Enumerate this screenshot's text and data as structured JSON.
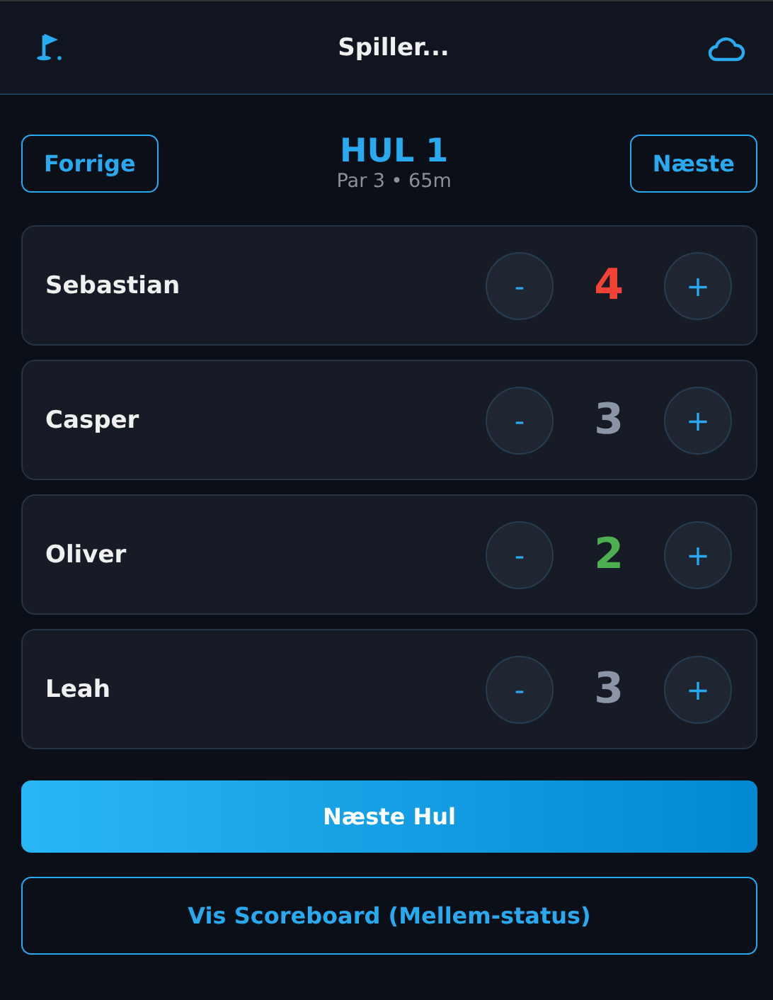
{
  "header": {
    "title": "Spiller..."
  },
  "hole": {
    "title": "HUL 1",
    "info": "Par 3 • 65m",
    "prev": "Forrige",
    "next": "Næste"
  },
  "players": [
    {
      "name": "Sebastian",
      "score": "4",
      "color": "#f44336",
      "minus": "-",
      "plus": "+"
    },
    {
      "name": "Casper",
      "score": "3",
      "color": "#8b95a5",
      "minus": "-",
      "plus": "+"
    },
    {
      "name": "Oliver",
      "score": "2",
      "color": "#4caf50",
      "minus": "-",
      "plus": "+"
    },
    {
      "name": "Leah",
      "score": "3",
      "color": "#8b95a5",
      "minus": "-",
      "plus": "+"
    }
  ],
  "actions": {
    "next_hole": "Næste Hul",
    "scoreboard": "Vis Scoreboard (Mellem-status)"
  }
}
